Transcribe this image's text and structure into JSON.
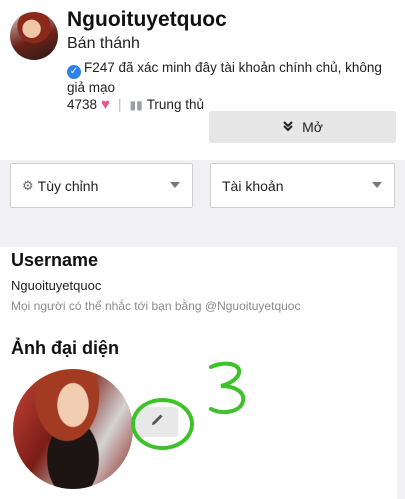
{
  "profile": {
    "username": "Nguoituyetquoc",
    "rank": "Bán thánh",
    "verified_text": "F247 đã xác minh đây tài khoản chính chủ, không giả mạo",
    "likes": "4738",
    "badge_label": "Trung thủ",
    "expand_label": "Mở"
  },
  "selects": {
    "customize": "Tùy chỉnh",
    "account": "Tài khoản"
  },
  "settings": {
    "username_heading": "Username",
    "username_value": "Nguoituyetquoc",
    "username_hint": "Mọi người có thể nhắc tới bạn bằng @Nguoituyetquoc",
    "avatar_heading": "Ảnh đại diện"
  },
  "annotation": {
    "number": "3",
    "color": "#3ec22a"
  },
  "icons": [
    "verified-icon",
    "heart-icon",
    "trophy-icon",
    "chevron-double-down-icon",
    "gear-icon",
    "caret-down-icon",
    "pencil-icon"
  ]
}
